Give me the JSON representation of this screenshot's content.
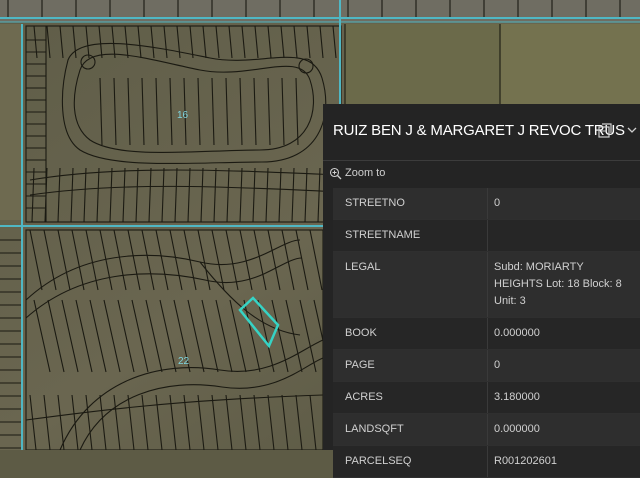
{
  "map": {
    "labels": [
      {
        "text": "16"
      },
      {
        "text": "22"
      }
    ],
    "colors": {
      "parcel_line": "#1a1a12",
      "road": "#4fb7c4",
      "highlight": "#36d3c5",
      "land": "#5d5b45"
    }
  },
  "popup": {
    "title": "RUIZ BEN J & MARGARET J REVOC TRUS",
    "dock_icon": "dock-icon",
    "collapse_icon": "chevron-down-icon",
    "zoom_to_label": "Zoom to",
    "attributes": [
      {
        "key": "STREETNO",
        "value": "0"
      },
      {
        "key": "STREETNAME",
        "value": ""
      },
      {
        "key": "LEGAL",
        "value": "Subd: MORIARTY HEIGHTS Lot: 18 Block: 8 Unit: 3"
      },
      {
        "key": "BOOK",
        "value": "0.000000"
      },
      {
        "key": "PAGE",
        "value": "0"
      },
      {
        "key": "ACRES",
        "value": "3.180000"
      },
      {
        "key": "LANDSQFT",
        "value": "0.000000"
      },
      {
        "key": "PARCELSEQ",
        "value": "R001202601"
      }
    ]
  }
}
